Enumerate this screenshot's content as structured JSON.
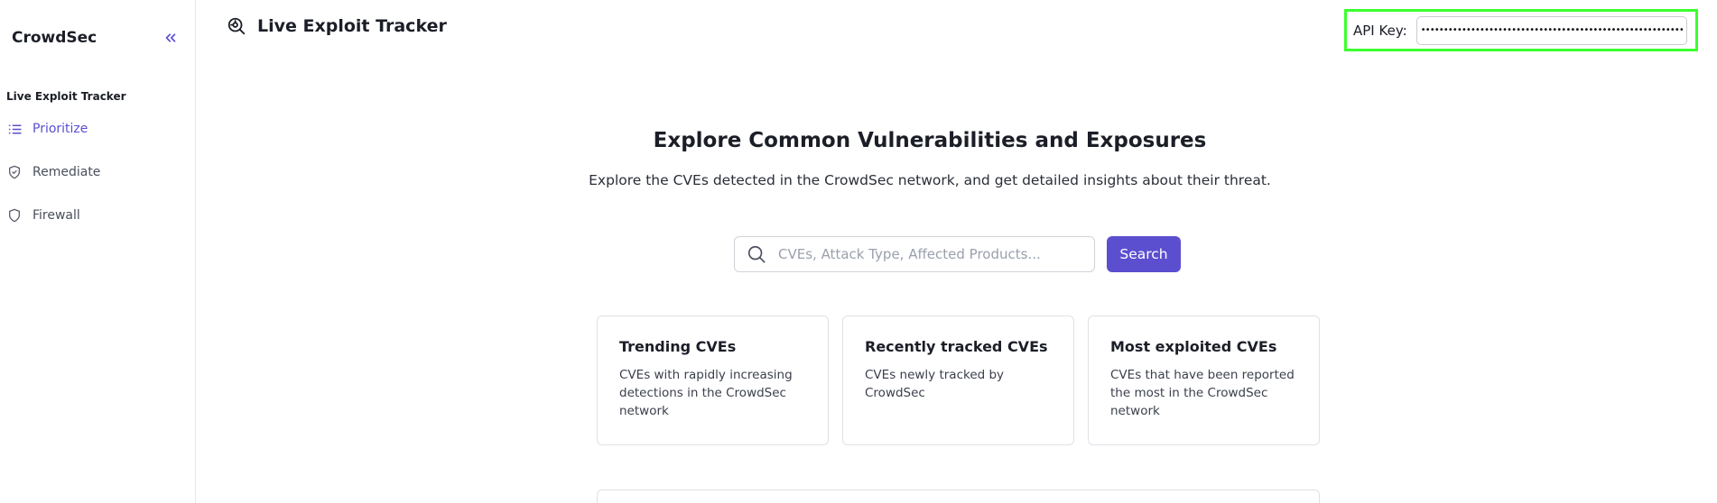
{
  "sidebar": {
    "brand": "CrowdSec",
    "section_label": "Live Exploit Tracker",
    "items": [
      {
        "label": "Prioritize",
        "icon": "list-icon",
        "active": true
      },
      {
        "label": "Remediate",
        "icon": "shield-check-icon",
        "active": false
      },
      {
        "label": "Firewall",
        "icon": "shield-icon",
        "active": false
      }
    ],
    "collapse_icon": "chevrons-left-icon"
  },
  "header": {
    "title": "Live Exploit Tracker",
    "icon": "magnifier-scan-icon",
    "api_key_label": "API Key:",
    "api_key_value": "••••••••••••••••••••••••••••••••••••••••••••••••••••••••••••••••••••"
  },
  "hero": {
    "title": "Explore Common Vulnerabilities and Exposures",
    "subtitle": "Explore the CVEs detected in the CrowdSec network, and get detailed insights about their threat."
  },
  "search": {
    "placeholder": "CVEs, Attack Type, Affected Products...",
    "value": "",
    "button_label": "Search"
  },
  "cards": [
    {
      "title": "Trending CVEs",
      "description": "CVEs with rapidly increasing detections in the CrowdSec network"
    },
    {
      "title": "Recently tracked CVEs",
      "description": "CVEs newly tracked by CrowdSec"
    },
    {
      "title": "Most exploited CVEs",
      "description": "CVEs that have been reported the most in the CrowdSec network"
    }
  ],
  "colors": {
    "accent": "#5b4fcf",
    "highlight_border": "#3bff2e",
    "border": "#dfe1e6"
  }
}
